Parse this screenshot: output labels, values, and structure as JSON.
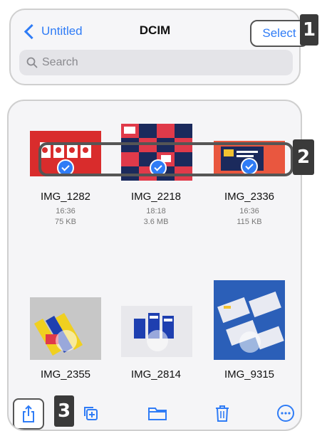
{
  "header": {
    "back_label": "Untitled",
    "title": "DCIM",
    "select_label": "Select"
  },
  "search": {
    "placeholder": "Search"
  },
  "callouts": {
    "one": "1",
    "two": "2",
    "three": "3"
  },
  "photos": [
    {
      "name": "IMG_1282",
      "time": "16:36",
      "size": "75 KB",
      "selected": true
    },
    {
      "name": "IMG_2218",
      "time": "18:18",
      "size": "3.6 MB",
      "selected": true
    },
    {
      "name": "IMG_2336",
      "time": "16:36",
      "size": "115 KB",
      "selected": true
    },
    {
      "name": "IMG_2355",
      "selected": false
    },
    {
      "name": "IMG_2814",
      "selected": false
    },
    {
      "name": "IMG_9315",
      "selected": false
    }
  ],
  "toolbar": [
    "share-icon",
    "duplicate-icon",
    "folder-icon",
    "trash-icon",
    "more-icon"
  ],
  "colors": {
    "accent": "#2f7cf6",
    "callout": "#3a3a3a"
  }
}
